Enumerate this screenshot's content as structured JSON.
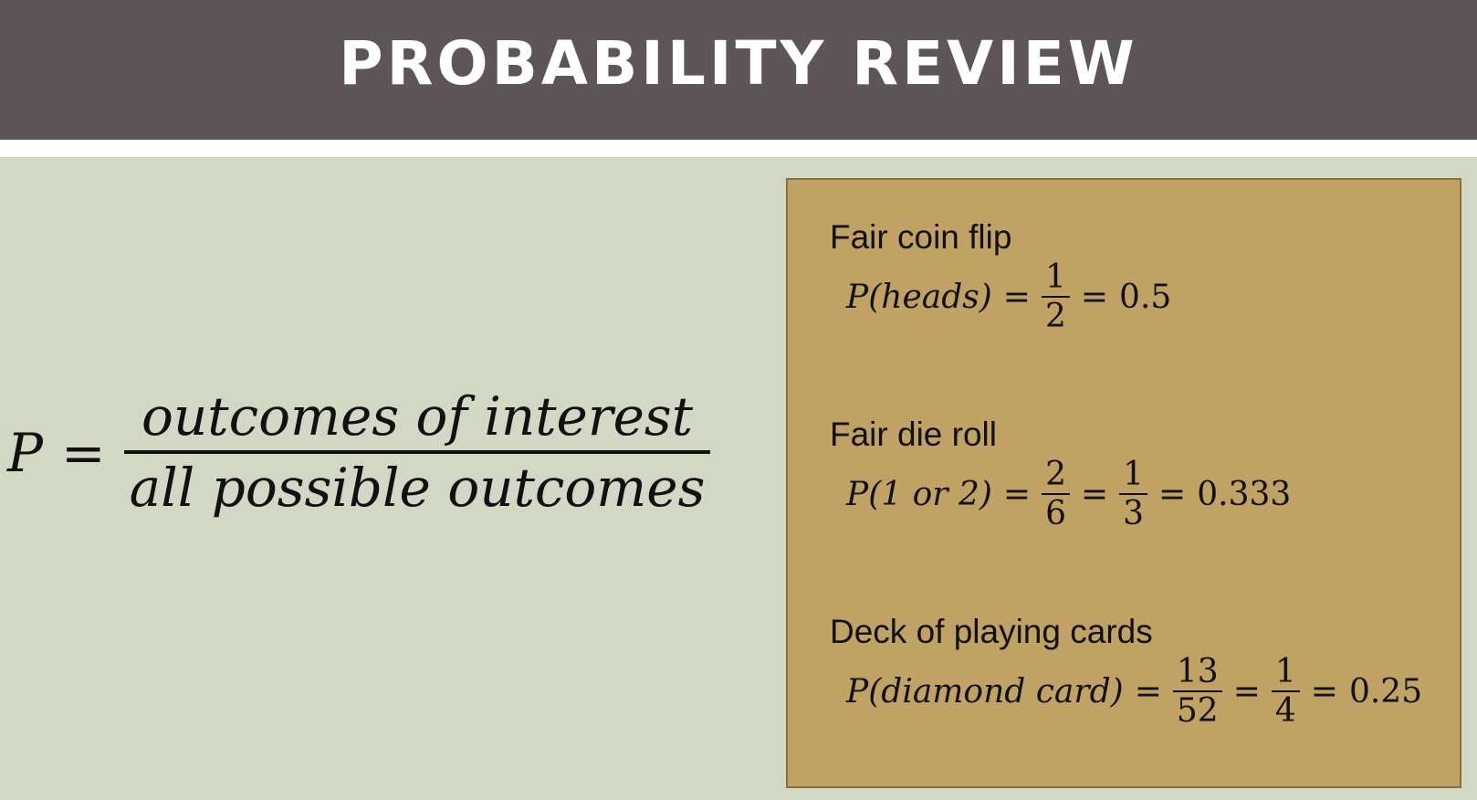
{
  "slide": {
    "title": "PROBABILITY REVIEW"
  },
  "formula": {
    "lhs": "P",
    "equals": "=",
    "numerator": "outcomes of interest",
    "denominator": "all possible outcomes"
  },
  "examples": [
    {
      "heading": "Fair coin flip",
      "lhs": "P(heads)",
      "fractions": [
        {
          "num": "1",
          "den": "2"
        }
      ],
      "result": "0.5"
    },
    {
      "heading": "Fair die roll",
      "lhs": "P(1 or 2)",
      "fractions": [
        {
          "num": "2",
          "den": "6"
        },
        {
          "num": "1",
          "den": "3"
        }
      ],
      "result": "0.333"
    },
    {
      "heading": "Deck of playing cards",
      "lhs": "P(diamond card)",
      "fractions": [
        {
          "num": "13",
          "den": "52"
        },
        {
          "num": "1",
          "den": "4"
        }
      ],
      "result": "0.25"
    }
  ],
  "colors": {
    "title_bar": "#5e5558",
    "background": "#d2d8c4",
    "panel": "#c0a264"
  }
}
